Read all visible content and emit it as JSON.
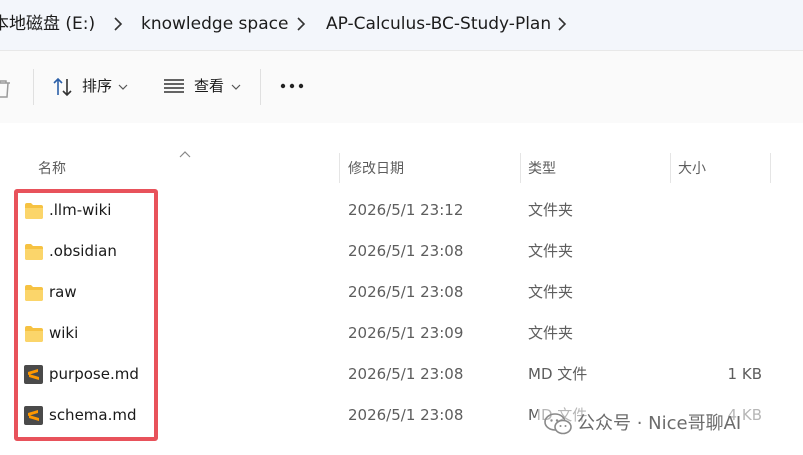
{
  "breadcrumb": {
    "items": [
      "本地磁盘 (E:)",
      "knowledge space",
      "AP-Calculus-BC-Study-Plan"
    ]
  },
  "toolbar": {
    "sort_label": "排序",
    "view_label": "查看",
    "more_label": "..."
  },
  "columns": {
    "name": "名称",
    "date_modified": "修改日期",
    "type": "类型",
    "size": "大小"
  },
  "files": [
    {
      "name": ".llm-wiki",
      "date": "2026/5/1 23:12",
      "type": "文件夹",
      "size": "",
      "icon": "folder-icon"
    },
    {
      "name": ".obsidian",
      "date": "2026/5/1 23:08",
      "type": "文件夹",
      "size": "",
      "icon": "folder-icon"
    },
    {
      "name": "raw",
      "date": "2026/5/1 23:08",
      "type": "文件夹",
      "size": "",
      "icon": "folder-icon"
    },
    {
      "name": "wiki",
      "date": "2026/5/1 23:09",
      "type": "文件夹",
      "size": "",
      "icon": "folder-icon"
    },
    {
      "name": "purpose.md",
      "date": "2026/5/1 23:08",
      "type": "MD 文件",
      "size": "1 KB",
      "icon": "sublime-text-file-icon"
    },
    {
      "name": "schema.md",
      "date": "2026/5/1 23:08",
      "type": "MD 文件",
      "size": "4 KB",
      "icon": "sublime-text-file-icon"
    }
  ],
  "colors": {
    "highlight": "#e8525b",
    "folder": "#f6c242",
    "sublime_accent": "#ff9800"
  },
  "watermark": {
    "text": "公众号 · Nice哥聊AI"
  }
}
